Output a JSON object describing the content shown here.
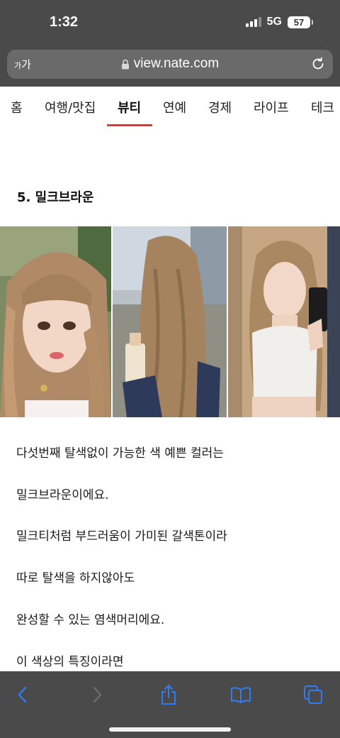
{
  "status_bar": {
    "time": "1:32",
    "network": "5G",
    "battery": "57"
  },
  "browser": {
    "text_size_label_small": "가",
    "text_size_label_large": "가",
    "url": "view.nate.com"
  },
  "categories": [
    {
      "label": "홈"
    },
    {
      "label": "여행/맛집"
    },
    {
      "label": "뷰티"
    },
    {
      "label": "연예"
    },
    {
      "label": "경제"
    },
    {
      "label": "라이프"
    },
    {
      "label": "테크"
    }
  ],
  "active_category": "뷰티",
  "article": {
    "heading": "5. 밀크브라운",
    "paragraphs": [
      "다섯번째 탈색없이 가능한 색 예쁜 컬러는",
      "밀크브라운이에요.",
      "밀크티처럼 부드러움이 가미된 갈색톤이라",
      "따로 탈색을 하지않아도",
      "완성할 수 있는 염색머리에요.",
      "이 색상의 특징이라면"
    ]
  },
  "toolbar": {
    "icons": [
      "back-icon",
      "forward-icon",
      "share-icon",
      "bookmarks-icon",
      "tabs-icon"
    ]
  },
  "colors": {
    "chrome": "#4a4a4a",
    "accent": "#e0382f",
    "toolbar_icon": "#2f7cf6"
  }
}
